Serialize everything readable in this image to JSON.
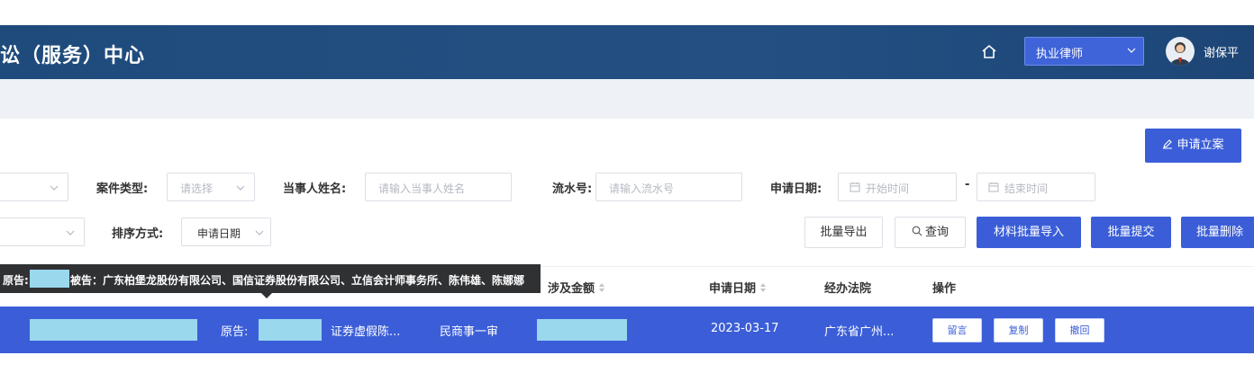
{
  "header": {
    "title": "讼（服务）中心",
    "role": "执业律师",
    "user": "谢保平",
    "icons": [
      "home-icon",
      "chevron-down-icon",
      "avatar"
    ]
  },
  "actions": {
    "apply": "申请立案"
  },
  "filters": {
    "case_type_label": "案件类型:",
    "case_type_placeholder": "请选择",
    "party_label": "当事人姓名:",
    "party_placeholder": "请输入当事人姓名",
    "serial_label": "流水号:",
    "serial_placeholder": "请输入流水号",
    "date_label": "申请日期:",
    "start_placeholder": "开始时间",
    "separator": "-",
    "end_placeholder": "结束时间",
    "sort_label": "排序方式:",
    "sort_value": "申请日期"
  },
  "toolbar": {
    "export": "批量导出",
    "query": "查询",
    "import": "材料批量导入",
    "submit": "批量提交",
    "delete": "批量删除"
  },
  "tooltip": {
    "plaintiff": "原告:",
    "defendant": "被告：广东柏堡龙股份有限公司、国信证券股份有限公司、立信会计师事务所、陈伟雄、陈娜娜"
  },
  "table": {
    "columns": {
      "amount": "涉及金额",
      "date": "申请日期",
      "court": "经办法院",
      "ops": "操作"
    },
    "rows": [
      {
        "party": "原告:",
        "cause": "证券虚假陈...",
        "procedure": "民商事一审",
        "date": "2023-03-17",
        "court": "广东省广州...",
        "ops": [
          "留言",
          "复制",
          "撤回"
        ]
      }
    ]
  },
  "colors": {
    "header": "#1f4b7c",
    "primary": "#3b5ed8",
    "mask": "#9ad8ee",
    "subbar": "#eef1f6"
  }
}
